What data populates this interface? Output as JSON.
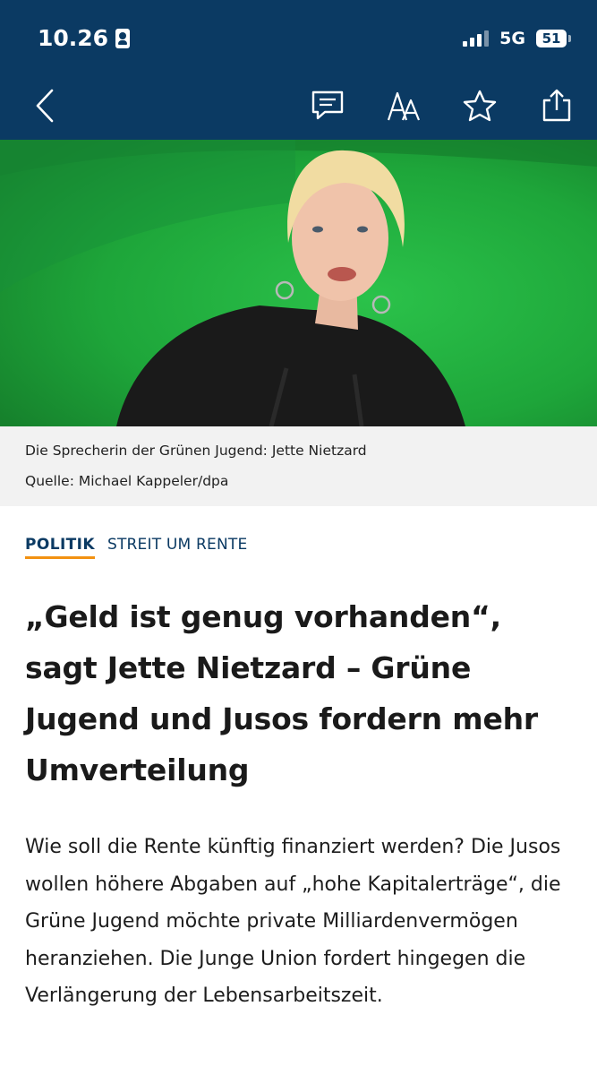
{
  "status_bar": {
    "time": "10.26",
    "network": "5G",
    "battery": "51"
  },
  "toolbar": {
    "icons": [
      "back-icon",
      "comment-icon",
      "text-size-icon",
      "bookmark-star-icon",
      "share-icon"
    ],
    "text_size_label": "AA"
  },
  "hero": {
    "background_color": "#1fae3b"
  },
  "caption": {
    "description": "Die Sprecherin der Grünen Jugend: Jette Nietzard",
    "source": "Quelle: Michael Kappeler/dpa"
  },
  "article": {
    "category": "POLITIK",
    "topic": "STREIT UM RENTE",
    "headline": "„Geld ist genug vorhanden“, sagt Jette Nietzard – Grüne Jugend und Jusos fordern mehr Umverteilung",
    "lead": "Wie soll die Rente künftig finanziert werden? Die Jusos wollen höhere Abgaben auf „hohe Kapitalerträge“, die Grüne Jugend möchte private Milliardenvermögen heranziehen. Die Junge Union fordert hingegen die Verlängerung der Lebensarbeitszeit."
  },
  "colors": {
    "header_bg": "#0b3a63",
    "accent_orange": "#f29111",
    "caption_bg": "#f2f2f2"
  }
}
